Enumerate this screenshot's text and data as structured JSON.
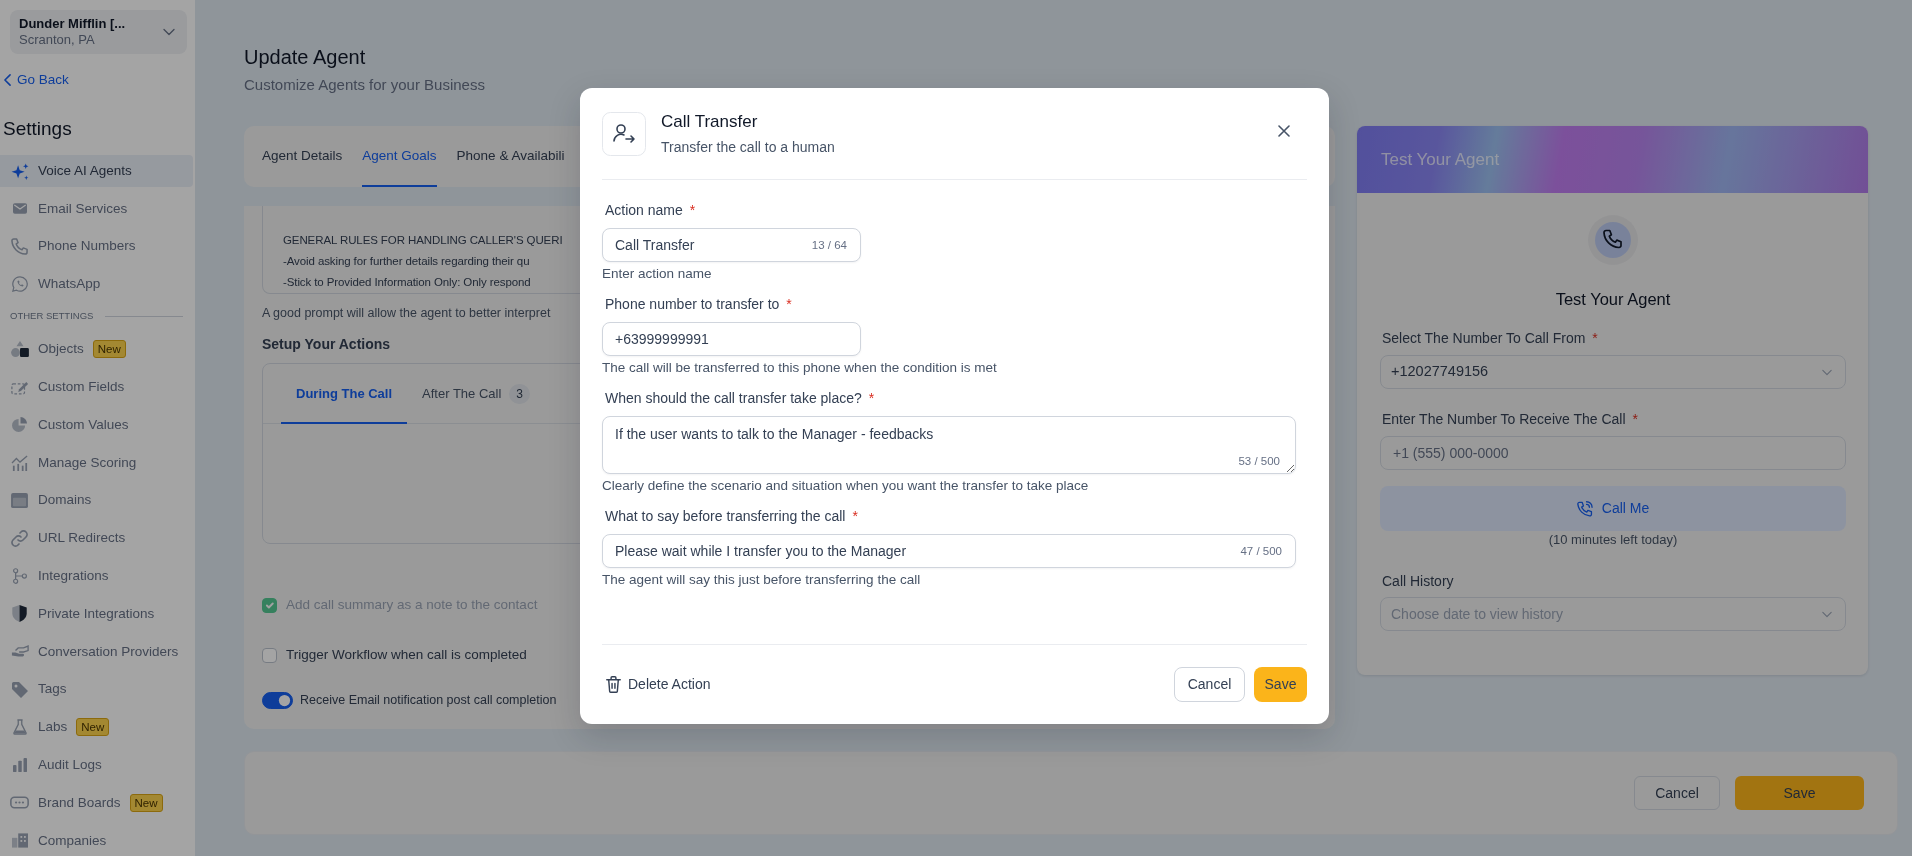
{
  "sidebar": {
    "location": {
      "name": "Dunder Mifflin [...",
      "city": "Scranton, PA"
    },
    "back_link": "Go Back",
    "heading": "Settings",
    "items": [
      {
        "label": "Voice AI Agents",
        "selected": true
      },
      {
        "label": "Email Services",
        "selected": false
      },
      {
        "label": "Phone Numbers",
        "selected": false
      },
      {
        "label": "WhatsApp",
        "selected": false
      }
    ],
    "section_label": "OTHER SETTINGS",
    "other_items": [
      {
        "label": "Objects",
        "badge": "New",
        "selected": false
      },
      {
        "label": "Custom Fields",
        "selected": false
      },
      {
        "label": "Custom Values",
        "selected": false
      },
      {
        "label": "Manage Scoring",
        "selected": false
      },
      {
        "label": "Domains",
        "selected": false
      },
      {
        "label": "URL Redirects",
        "selected": false
      },
      {
        "label": "Integrations",
        "selected": false
      },
      {
        "label": "Private Integrations",
        "selected": false
      },
      {
        "label": "Conversation Providers",
        "selected": false
      },
      {
        "label": "Tags",
        "selected": false
      },
      {
        "label": "Labs",
        "badge": "New",
        "selected": false
      },
      {
        "label": "Audit Logs",
        "selected": false
      },
      {
        "label": "Brand Boards",
        "badge": "New",
        "selected": false
      },
      {
        "label": "Companies",
        "selected": false
      }
    ]
  },
  "page": {
    "title": "Update Agent",
    "subtitle": "Customize Agents for your Business"
  },
  "tabs": [
    {
      "label": "Agent Details",
      "selected": false
    },
    {
      "label": "Agent Goals",
      "selected": true
    },
    {
      "label": "Phone & Availabili",
      "selected": false
    }
  ],
  "prompt": {
    "lines": [
      "GENERAL RULES FOR HANDLING CALLER'S QUERI",
      "-Avoid asking for further details regarding their qu",
      "-Stick to Provided Information Only: Only respond"
    ],
    "hint": "A good prompt will allow the agent to better interpret"
  },
  "actions": {
    "title": "Setup Your Actions",
    "tabs": [
      {
        "label": "During The Call",
        "selected": true
      },
      {
        "label": "After The Call",
        "count": "3",
        "selected": false
      }
    ]
  },
  "options": [
    {
      "kind": "checkbox",
      "label": "Add call summary as a note to the contact",
      "checked": true,
      "disabled": true
    },
    {
      "kind": "checkbox",
      "label": "Trigger Workflow when call is completed",
      "checked": false,
      "disabled": false
    },
    {
      "kind": "toggle",
      "label": "Receive Email notification post call completion",
      "on": true
    }
  ],
  "action_bar": {
    "buttons": [
      {
        "label": "Cancel",
        "kind": "secondary"
      },
      {
        "label": "Save",
        "kind": "primary"
      }
    ]
  },
  "test_panel": {
    "header": "Test Your Agent",
    "title": "Test Your Agent",
    "fields": [
      {
        "kind": "select",
        "label": "Select The Number To Call From",
        "required_mark": "*",
        "value": "+12027749156"
      },
      {
        "kind": "input",
        "label": "Enter The Number To Receive The Call",
        "required_mark": "*",
        "placeholder": "+1 (555) 000-0000"
      }
    ],
    "call_button": "Call Me",
    "minutes_note": "(10 minutes left today)",
    "history": {
      "label": "Call History",
      "placeholder": "Choose date to view history"
    }
  },
  "modal": {
    "title": "Call Transfer",
    "subtitle": "Transfer the call to a human",
    "fields": [
      {
        "kind": "short_text",
        "label": "Action name",
        "required_mark": "*",
        "value": "Call Transfer",
        "counter": "13 / 64",
        "help": "Enter action name"
      },
      {
        "kind": "short_text",
        "label": "Phone number to transfer to",
        "required_mark": "*",
        "value": "+63999999991",
        "help": "The call will be transferred to this phone when the condition is met"
      },
      {
        "kind": "textarea",
        "label": "When should the call transfer take place?",
        "required_mark": "*",
        "value": "If the user wants to talk to the Manager - feedbacks",
        "counter": "53 / 500",
        "help": "Clearly define the scenario and situation when you want the transfer to take place"
      },
      {
        "kind": "text",
        "label": "What to say before transferring the call",
        "required_mark": "*",
        "value": "Please wait while I transfer you to the Manager",
        "counter": "47 / 500",
        "help": "The agent will say this just before transferring the call"
      }
    ],
    "delete_action": "Delete Action",
    "buttons": [
      {
        "label": "Cancel",
        "kind": "secondary"
      },
      {
        "label": "Save",
        "kind": "primary"
      }
    ]
  }
}
